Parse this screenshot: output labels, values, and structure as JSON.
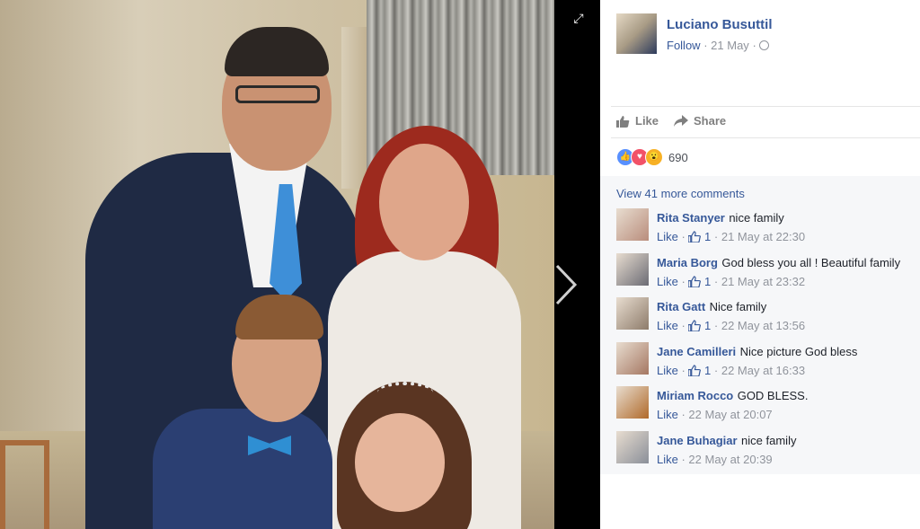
{
  "post": {
    "author": "Luciano Busuttil",
    "follow_label": "Follow",
    "date": "21 May",
    "separator": "·"
  },
  "actions": {
    "like_label": "Like",
    "share_label": "Share"
  },
  "reactions": {
    "count": "690",
    "types": [
      "like",
      "love",
      "wow"
    ]
  },
  "comments_section": {
    "view_more": "View 41 more comments",
    "comments": [
      {
        "author": "Rita Stanyer",
        "text": "nice family",
        "like_label": "Like",
        "likes": "1",
        "time": "21 May at 22:30"
      },
      {
        "author": "Maria Borg",
        "text": "God bless you all ! Beautiful family",
        "like_label": "Like",
        "likes": "1",
        "time": "21 May at 23:32"
      },
      {
        "author": "Rita Gatt",
        "text": "Nice family",
        "like_label": "Like",
        "likes": "1",
        "time": "22 May at 13:56"
      },
      {
        "author": "Jane Camilleri",
        "text": "Nice picture God bless",
        "like_label": "Like",
        "likes": "1",
        "time": "22 May at 16:33"
      },
      {
        "author": "Miriam Rocco",
        "text": "GOD BLESS.",
        "like_label": "Like",
        "likes": "",
        "time": "22 May at 20:07"
      },
      {
        "author": "Jane Buhagiar",
        "text": "nice family",
        "like_label": "Like",
        "likes": "",
        "time": "22 May at 20:39"
      }
    ]
  },
  "colors": {
    "link_blue": "#365899",
    "meta_gray": "#90949c",
    "comments_bg": "#f6f7f9"
  },
  "icons": [
    "expand-icon",
    "next-arrow-icon",
    "globe-icon",
    "like-thumb-icon",
    "share-arrow-icon"
  ]
}
